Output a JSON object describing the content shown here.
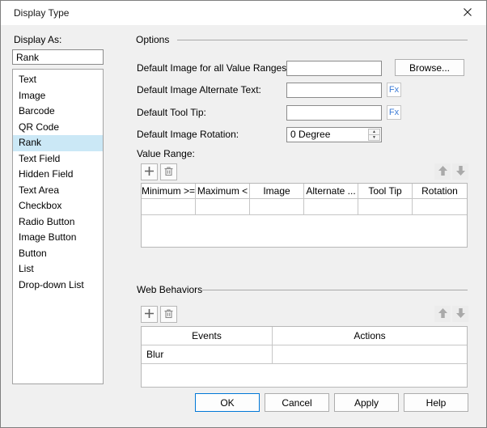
{
  "window": {
    "title": "Display Type"
  },
  "icons": {
    "close": "x-cross",
    "add": "plus",
    "delete": "trash-can",
    "move_up": "arrow-up",
    "move_down": "arrow-down",
    "spin_up": "triangle-up",
    "spin_down": "triangle-down"
  },
  "left_panel": {
    "label": "Display As:",
    "value": "Rank",
    "selected_item": "Rank",
    "selected_index": 4,
    "items": [
      "Text",
      "Image",
      "Barcode",
      "QR Code",
      "Rank",
      "Text Field",
      "Hidden Field",
      "Text Area",
      "Checkbox",
      "Radio Button",
      "Image Button",
      "Button",
      "List",
      "Drop-down List"
    ]
  },
  "options": {
    "group_label": "Options",
    "fields": [
      {
        "label": "Default Image for all Value Ranges:",
        "value": "",
        "button": "Browse..."
      },
      {
        "label": "Default Image Alternate Text:",
        "value": "",
        "button": "Fx"
      },
      {
        "label": "Default Tool Tip:",
        "value": "",
        "button": "Fx"
      },
      {
        "label": "Default Image Rotation:",
        "value": "0 Degree"
      }
    ],
    "value_range": {
      "label": "Value Range:",
      "columns": [
        "Minimum >=",
        "Maximum <",
        "Image",
        "Alternate ...",
        "Tool Tip",
        "Rotation"
      ],
      "rows": [
        [
          "",
          "",
          "",
          "",
          "",
          ""
        ]
      ]
    }
  },
  "web_behaviors": {
    "group_label": "Web Behaviors",
    "columns": [
      "Events",
      "Actions"
    ],
    "rows": [
      [
        "Blur",
        ""
      ]
    ]
  },
  "footer": {
    "buttons": [
      "OK",
      "Cancel",
      "Apply",
      "Help"
    ]
  },
  "colors": {
    "dialog_bg": "#f0f0f0",
    "titlebar_bg": "#ffffff",
    "selection_bg": "#cbe8f6",
    "accent_blue": "#0078d7",
    "fx_blue": "#3b7bd6"
  }
}
